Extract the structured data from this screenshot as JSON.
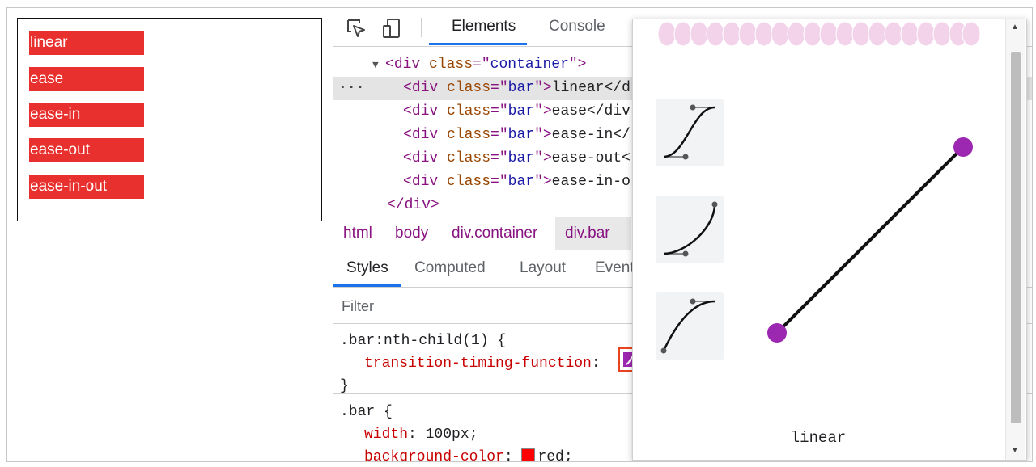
{
  "preview": {
    "bars": [
      "linear",
      "ease",
      "ease-in",
      "ease-out",
      "ease-in-out"
    ]
  },
  "devtools": {
    "tabs": [
      "Elements",
      "Console"
    ],
    "dom": {
      "container_open": {
        "tag": "div",
        "attr": "class",
        "value": "container"
      },
      "rows": [
        {
          "tag": "div",
          "attr": "class",
          "value": "bar",
          "text": "linear</d"
        },
        {
          "tag": "div",
          "attr": "class",
          "value": "bar",
          "text": "ease</div"
        },
        {
          "tag": "div",
          "attr": "class",
          "value": "bar",
          "text": "ease-in</"
        },
        {
          "tag": "div",
          "attr": "class",
          "value": "bar",
          "text": "ease-out<"
        },
        {
          "tag": "div",
          "attr": "class",
          "value": "bar",
          "text": "ease-in-o"
        }
      ],
      "container_close": "</div>"
    },
    "breadcrumbs": [
      "html",
      "body",
      "div.container",
      "div.bar"
    ],
    "subtabs": [
      "Styles",
      "Computed",
      "Layout",
      "Event"
    ],
    "filter_placeholder": "Filter",
    "rules": [
      {
        "selector": ".bar:nth-child(1) {",
        "props": [
          {
            "name": "transition-timing-function",
            "value": ""
          }
        ],
        "close": "}"
      },
      {
        "selector": ".bar {",
        "props": [
          {
            "name": "width",
            "value": "100px;"
          },
          {
            "name": "background-color",
            "value": "red;"
          }
        ]
      }
    ]
  },
  "popover": {
    "current_easing": "linear",
    "presets": [
      "ease-in-out",
      "ease-in",
      "ease-out"
    ],
    "accent_color": "#9c27b0",
    "anim_dot_color": "#f3d3ea"
  }
}
